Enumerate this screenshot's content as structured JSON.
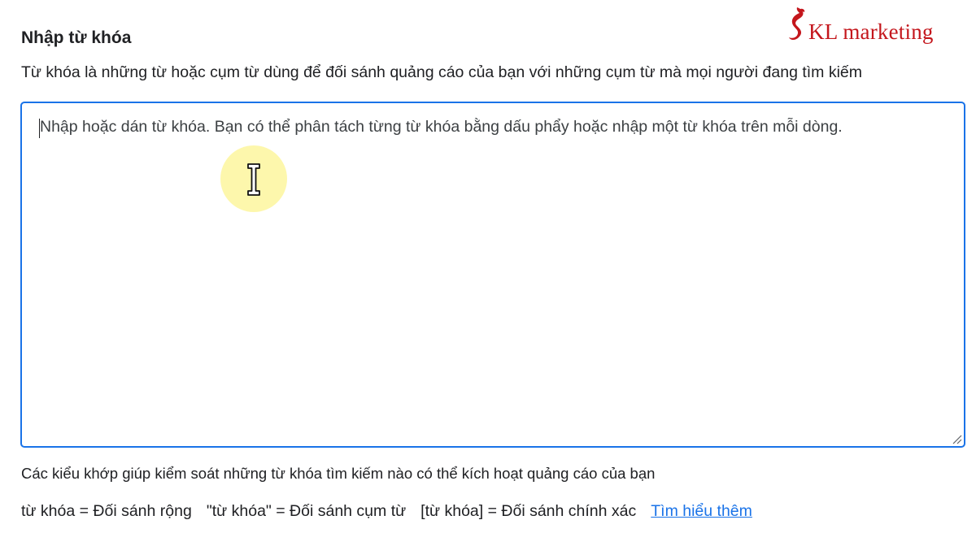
{
  "logo": {
    "text": "KL marketing",
    "color": "#c4161c"
  },
  "header": {
    "title": "Nhập từ khóa",
    "description": "Từ khóa là những từ hoặc cụm từ dùng để đối sánh quảng cáo của bạn với những cụm từ mà mọi người đang tìm kiếm"
  },
  "keyword_input": {
    "value": "",
    "placeholder": "Nhập hoặc dán từ khóa. Bạn có thể phân tách từng từ khóa bằng dấu phẩy hoặc nhập một từ khóa trên mỗi dòng."
  },
  "match_types": {
    "info": "Các kiểu khớp giúp kiểm soát những từ khóa tìm kiếm nào có thể kích hoạt quảng cáo của bạn",
    "broad": "từ khóa = Đối sánh rộng",
    "phrase": "\"từ khóa\" = Đối sánh cụm từ",
    "exact": "[từ khóa] = Đối sánh chính xác",
    "learn_more": "Tìm hiểu thêm"
  },
  "colors": {
    "accent": "#1a73e8",
    "text": "#202124",
    "cursor_highlight": "#fdf69e"
  },
  "icons": {
    "logo_mark": "phoenix-s-logo-icon",
    "cursor": "text-cursor-icon",
    "resize": "resize-handle-icon"
  }
}
